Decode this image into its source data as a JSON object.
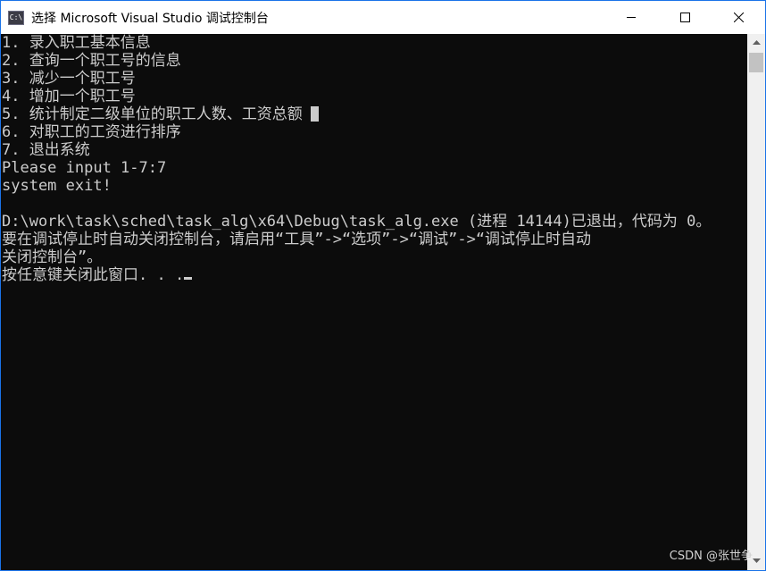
{
  "window": {
    "title": "选择 Microsoft Visual Studio 调试控制台",
    "icon_label": "C:\\",
    "controls": [
      "minimize-icon",
      "maximize-icon",
      "close-icon"
    ]
  },
  "console": {
    "lines": [
      "1. 录入职工基本信息",
      "2. 查询一个职工号的信息",
      "3. 减少一个职工号",
      "4. 增加一个职工号",
      "5. 统计制定二级单位的职工人数、工资总额",
      "6. 对职工的工资进行排序",
      "7. 退出系统",
      "Please input 1-7:7",
      "system exit!",
      "",
      "D:\\work\\task\\sched\\task_alg\\x64\\Debug\\task_alg.exe (进程 14144)已退出，代码为 0。",
      "要在调试停止时自动关闭控制台，请启用“工具”->“选项”->“调试”->“调试停止时自动",
      "关闭控制台”。",
      "按任意键关闭此窗口. . ."
    ]
  },
  "watermark": "CSDN @张世争",
  "colors": {
    "console_bg": "#0c0c0c",
    "console_fg": "#cccccc",
    "titlebar_bg": "#ffffff",
    "scrollbar_bg": "#f0f0f0"
  }
}
